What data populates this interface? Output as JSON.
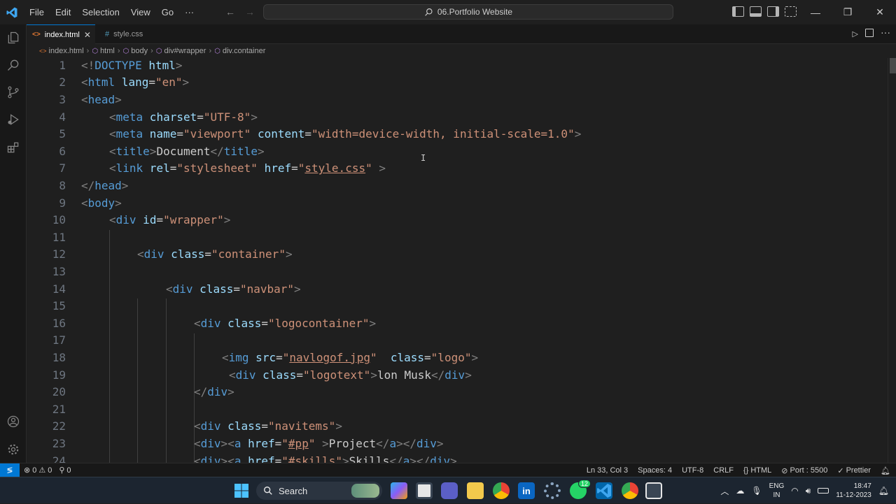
{
  "menu": [
    "File",
    "Edit",
    "Selection",
    "View",
    "Go",
    "···"
  ],
  "command_center": {
    "label": "06.Portfolio Website"
  },
  "tabs": [
    {
      "label": "index.html",
      "icon": "html-file-icon",
      "active": true
    },
    {
      "label": "style.css",
      "icon": "css-hash-icon",
      "active": false
    }
  ],
  "breadcrumb": [
    "index.html",
    "html",
    "body",
    "div#wrapper",
    "div.container"
  ],
  "line_numbers": [
    "1",
    "2",
    "3",
    "4",
    "5",
    "6",
    "7",
    "8",
    "9",
    "10",
    "11",
    "12",
    "13",
    "14",
    "15",
    "16",
    "17",
    "18",
    "19",
    "20",
    "21",
    "22",
    "23",
    "24"
  ],
  "code": {
    "l1": {
      "a": "<!",
      "b": "DOCTYPE",
      "c": " html",
      "d": ">"
    },
    "l2": {
      "a": "<",
      "b": "html",
      "c": " lang",
      "d": "=",
      "e": "\"en\"",
      "f": ">"
    },
    "l3": {
      "a": "<",
      "b": "head",
      "c": ">"
    },
    "l4": {
      "a": "<",
      "b": "meta",
      "c": " charset",
      "d": "=",
      "e": "\"UTF-8\"",
      "f": ">"
    },
    "l5": {
      "a": "<",
      "b": "meta",
      "c": " name",
      "d": "=",
      "e": "\"viewport\"",
      "g": " content",
      "h": "=",
      "i": "\"width=device-width, initial-scale=1.0\"",
      "f": ">"
    },
    "l6": {
      "a": "<",
      "b": "title",
      "c": ">",
      "d": "Document",
      "e": "</",
      "f": "title",
      "g": ">"
    },
    "l7": {
      "a": "<",
      "b": "link",
      "c": " rel",
      "d": "=",
      "e": "\"stylesheet\"",
      "g": " href",
      "h": "=",
      "i1": "\"",
      "i": "style.css",
      "i2": "\"",
      "f": " >"
    },
    "l8": {
      "a": "</",
      "b": "head",
      "c": ">"
    },
    "l9": {
      "a": "<",
      "b": "body",
      "c": ">"
    },
    "l10": {
      "a": "<",
      "b": "div",
      "c": " id",
      "d": "=",
      "e": "\"wrapper\"",
      "f": ">"
    },
    "l12": {
      "a": "<",
      "b": "div",
      "c": " class",
      "d": "=",
      "e": "\"container\"",
      "f": ">"
    },
    "l14": {
      "a": "<",
      "b": "div",
      "c": " class",
      "d": "=",
      "e": "\"navbar\"",
      "f": ">"
    },
    "l16": {
      "a": "<",
      "b": "div",
      "c": " class",
      "d": "=",
      "e": "\"logocontainer\"",
      "f": ">"
    },
    "l18": {
      "a": "<",
      "b": "img",
      "c": " src",
      "d": "=",
      "e1": "\"",
      "e": "navlogof.jpg",
      "e2": "\"",
      "g": "  class",
      "h": "=",
      "i": "\"logo\"",
      "f": ">"
    },
    "l19": {
      "a": "<",
      "b": "div",
      "c": " class",
      "d": "=",
      "e": "\"logotext\"",
      "f": ">",
      "t": "lon Musk",
      "x": "</",
      "y": "div",
      "z": ">"
    },
    "l20": {
      "a": "</",
      "b": "div",
      "c": ">"
    },
    "l22": {
      "a": "<",
      "b": "div",
      "c": " class",
      "d": "=",
      "e": "\"navitems\"",
      "f": ">"
    },
    "l23": {
      "a": "<",
      "b": "div",
      "c": ">",
      "a2": "<",
      "b2": "a",
      "c2": " href",
      "d2": "=",
      "e1": "\"",
      "e": "#pp",
      "e2": "\"",
      "f2": " >",
      "t": "Project",
      "x": "</",
      "y": "a",
      "z": ">",
      "x2": "</",
      "y2": "div",
      "z2": ">"
    },
    "l24": {
      "a": "<",
      "b": "div",
      "c": ">",
      "a2": "<",
      "b2": "a",
      "c2": " href",
      "d2": "=",
      "e1": "\"",
      "e": "#skills",
      "e2": "\"",
      "f2": ">",
      "t": "Skills",
      "x": "</",
      "y": "a",
      "z": ">",
      "x2": "</",
      "y2": "div",
      "z2": ">"
    }
  },
  "status": {
    "errors": "0",
    "warnings": "0",
    "ports": "0",
    "position": "Ln 33, Col 3",
    "spaces": "Spaces: 4",
    "encoding": "UTF-8",
    "eol": "CRLF",
    "language": "HTML",
    "port": "Port : 5500",
    "prettier": "Prettier"
  },
  "taskbar": {
    "search": "Search",
    "lang_top": "ENG",
    "lang_bottom": "IN",
    "time": "18:47",
    "date": "11-12-2023",
    "whatsapp_badge": "12"
  },
  "colors": {
    "accent": "#0078d4",
    "tag": "#569cd6",
    "attr": "#9cdcfe",
    "string": "#ce9178"
  }
}
